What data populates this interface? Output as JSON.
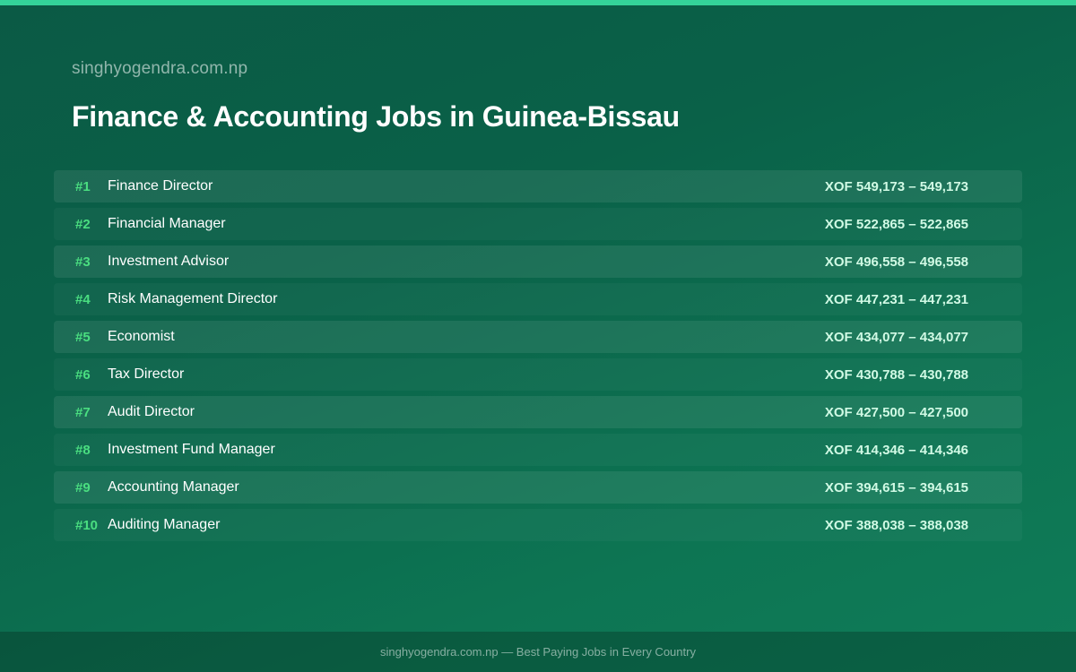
{
  "header": {
    "site": "singhyogendra.com.np",
    "title": "Finance & Accounting Jobs in Guinea-Bissau"
  },
  "colors": {
    "accent": "#34d399",
    "rank": "#4ade80",
    "background": "#0b5a45"
  },
  "jobs": [
    {
      "rank": "#1",
      "title": "Finance Director",
      "salary": "XOF 549,173 – 549,173"
    },
    {
      "rank": "#2",
      "title": "Financial Manager",
      "salary": "XOF 522,865 – 522,865"
    },
    {
      "rank": "#3",
      "title": "Investment Advisor",
      "salary": "XOF 496,558 – 496,558"
    },
    {
      "rank": "#4",
      "title": "Risk Management Director",
      "salary": "XOF 447,231 – 447,231"
    },
    {
      "rank": "#5",
      "title": "Economist",
      "salary": "XOF 434,077 – 434,077"
    },
    {
      "rank": "#6",
      "title": "Tax Director",
      "salary": "XOF 430,788 – 430,788"
    },
    {
      "rank": "#7",
      "title": "Audit Director",
      "salary": "XOF 427,500 – 427,500"
    },
    {
      "rank": "#8",
      "title": "Investment Fund Manager",
      "salary": "XOF 414,346 – 414,346"
    },
    {
      "rank": "#9",
      "title": "Accounting Manager",
      "salary": "XOF 394,615 – 394,615"
    },
    {
      "rank": "#10",
      "title": "Auditing Manager",
      "salary": "XOF 388,038 – 388,038"
    }
  ],
  "footer": {
    "text": "singhyogendra.com.np — Best Paying Jobs in Every Country"
  }
}
